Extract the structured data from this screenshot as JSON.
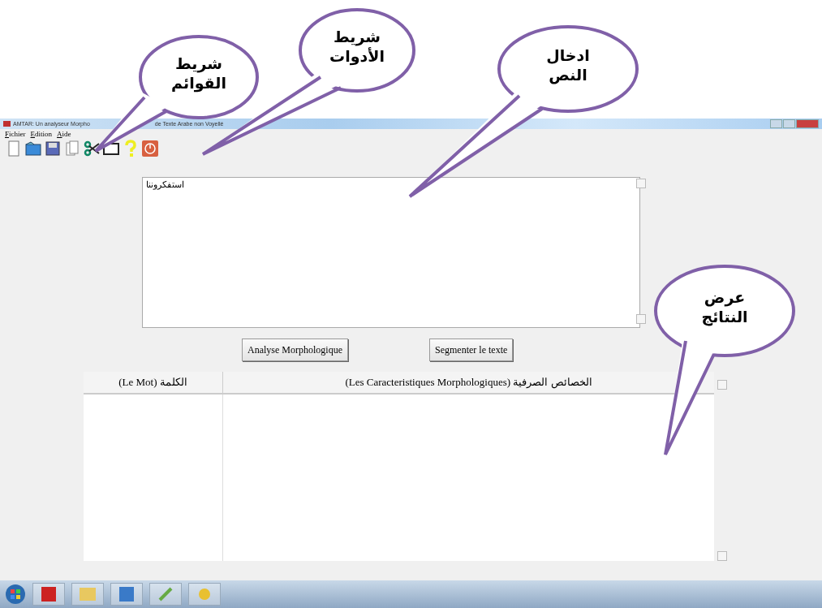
{
  "window": {
    "title_start": "AMTAR: Un analyseur Morpho",
    "title_end": "de Texte Arabe non Voyellé"
  },
  "menu": {
    "file": "Fichier",
    "edit": "Edition",
    "help": "Aide"
  },
  "input": {
    "value": "استفكروننا"
  },
  "buttons": {
    "analyse": "Analyse Morphologique",
    "segment": "Segmenter le texte"
  },
  "table": {
    "word_column": "(Le Mot)  الكلمة",
    "features_column": "(Les Caracteristiques Morphologiques) الخصائص الصرفية"
  },
  "callouts": [
    {
      "lines": [
        "شريط",
        "القوائم"
      ]
    },
    {
      "lines": [
        "شريط",
        "الأدوات"
      ]
    },
    {
      "lines": [
        "ادخال",
        "النص"
      ]
    },
    {
      "lines": [
        "عرض",
        "النتائج"
      ]
    }
  ]
}
